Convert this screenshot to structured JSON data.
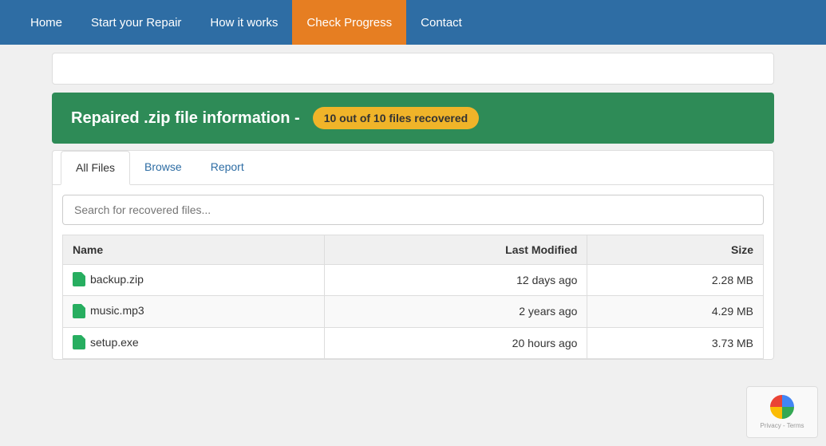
{
  "nav": {
    "items": [
      {
        "label": "Home",
        "id": "home",
        "active": false
      },
      {
        "label": "Start your Repair",
        "id": "start-repair",
        "active": false
      },
      {
        "label": "How it works",
        "id": "how-it-works",
        "active": false
      },
      {
        "label": "Check Progress",
        "id": "check-progress",
        "active": true
      },
      {
        "label": "Contact",
        "id": "contact",
        "active": false
      }
    ]
  },
  "banner": {
    "title": "Repaired .zip file information -",
    "badge": "10 out of 10 files recovered"
  },
  "tabs": {
    "items": [
      {
        "label": "All Files",
        "active": true,
        "link": false
      },
      {
        "label": "Browse",
        "active": false,
        "link": true
      },
      {
        "label": "Report",
        "active": false,
        "link": true
      }
    ]
  },
  "search": {
    "placeholder": "Search for recovered files..."
  },
  "table": {
    "columns": [
      {
        "label": "Name",
        "align": "left"
      },
      {
        "label": "Last Modified",
        "align": "right"
      },
      {
        "label": "Size",
        "align": "right"
      }
    ],
    "rows": [
      {
        "name": "backup.zip",
        "modified": "12 days ago",
        "size": "2.28 MB"
      },
      {
        "name": "music.mp3",
        "modified": "2 years ago",
        "size": "4.29 MB"
      },
      {
        "name": "setup.exe",
        "modified": "20 hours ago",
        "size": "3.73 MB"
      }
    ]
  },
  "recaptcha": {
    "text": "Privacy - Terms"
  }
}
